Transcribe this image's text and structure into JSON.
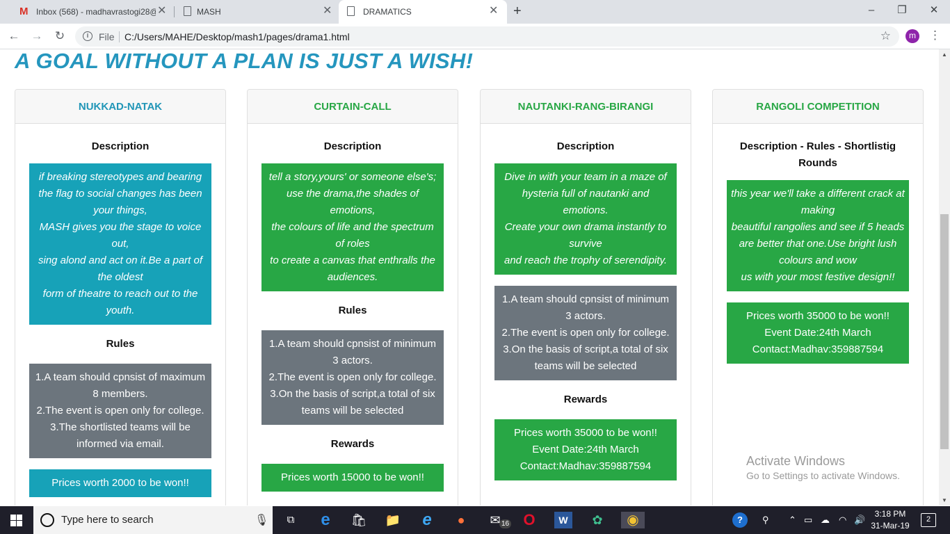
{
  "browser": {
    "tabs": [
      {
        "title": "Inbox (568) - madhavrastogi28@",
        "icon": "gmail-icon"
      },
      {
        "title": "MASH",
        "icon": "document-icon"
      },
      {
        "title": "DRAMATICS",
        "icon": "document-icon"
      }
    ],
    "active_tab": 2,
    "new_tab": "+",
    "address": {
      "protocol_label": "File",
      "url": "C:/Users/MAHE/Desktop/mash1/pages/drama1.html"
    },
    "profile_initial": "m",
    "window_controls": {
      "minimize": "–",
      "maximize": "❐",
      "close": "✕"
    }
  },
  "page": {
    "motto": "A GOAL WITHOUT A PLAN IS JUST A WISH!",
    "cards": [
      {
        "title": "NUKKAD-NATAK",
        "title_color": "#2196b7",
        "description_heading": "Description",
        "description": "if breaking stereotypes and bearing the flag to social changes has been your things,\nMASH gives you the stage to voice out,\nsing alond and act on it.Be a part of the oldest\nform of theatre to reach out to the youth.",
        "rules_heading": "Rules",
        "rules": "1.A team should cpnsist of maximum 8 members.\n2.The event is open only for college.\n3.The shortlisted teams will be informed via email.",
        "rewards": "Prices worth 2000 to be won!!"
      },
      {
        "title": "CURTAIN-CALL",
        "title_color": "#28a745",
        "description_heading": "Description",
        "description": "tell a story,yours' or someone else's;\nuse the drama,the shades of emotions,\nthe colours of life and the spectrum of roles\nto create a canvas that enthralls the audiences.",
        "rules_heading": "Rules",
        "rules": "1.A team should cpnsist of minimum 3 actors.\n2.The event is open only for college.\n3.On the basis of script,a total of six teams will be selected",
        "rewards_heading": "Rewards",
        "rewards": "Prices worth 15000 to be won!!"
      },
      {
        "title": "NAUTANKI-RANG-BIRANGI",
        "title_color": "#28a745",
        "description_heading": "Description",
        "description": "Dive in with your team in a maze of\nhysteria full of nautanki and emotions.\nCreate your own drama instantly to survive\nand reach the trophy of serendipity.",
        "rules": "1.A team should cpnsist of minimum 3 actors.\n2.The event is open only for college.\n3.On the basis of script,a total of six teams will be selected",
        "rewards_heading": "Rewards",
        "rewards": "Prices worth 35000 to be won!!\nEvent Date:24th March\nContact:Madhav:359887594"
      },
      {
        "title": "RANGOLI COMPETITION",
        "title_color": "#28a745",
        "description_heading": "Description - Rules - Shortlistig Rounds",
        "description": "this year we'll take a different crack at making\nbeautiful rangolies and see if 5 heads\nare better that one.Use bright lush colours and wow\nus with your most festive design!!",
        "rewards": "Prices worth 35000 to be won!!\nEvent Date:24th March\nContact:Madhav:359887594"
      }
    ]
  },
  "watermark": {
    "line1": "Activate Windows",
    "line2": "Go to Settings to activate Windows."
  },
  "taskbar": {
    "search_placeholder": "Type here to search",
    "mail_badge": "16",
    "clock_time": "3:18 PM",
    "clock_date": "31-Mar-19",
    "notification_count": "2"
  }
}
